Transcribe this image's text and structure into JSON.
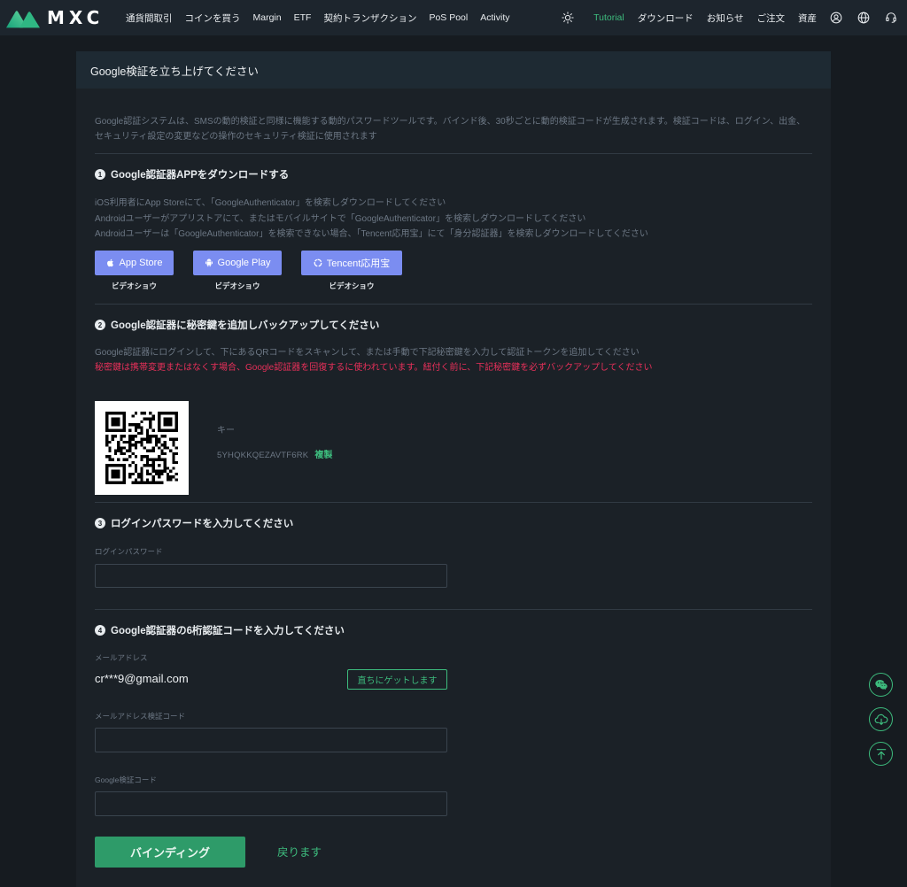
{
  "nav": {
    "logo": {
      "text": "MXC",
      "icon": "mxc-logo-icon"
    },
    "menu": [
      {
        "label": "通貨間取引"
      },
      {
        "label": "コインを買う"
      },
      {
        "label": "Margin"
      },
      {
        "label": "ETF"
      },
      {
        "label": "契約トランザクション"
      },
      {
        "label": "PoS Pool"
      },
      {
        "label": "Activity"
      }
    ],
    "theme_icon": "sun-icon",
    "right_menu": [
      {
        "label": "Tutorial"
      },
      {
        "label": "ダウンロード"
      },
      {
        "label": "お知らせ"
      },
      {
        "label": "ご注文"
      },
      {
        "label": "資産"
      }
    ],
    "right_icons": [
      "user-icon",
      "globe-icon",
      "support-icon"
    ]
  },
  "page": {
    "title": "Google検証を立ち上げてください",
    "intro": "Google認証システムは、SMSの動的検証と同様に機能する動的パスワードツールです。バインド後、30秒ごとに動的検証コードが生成されます。検証コードは、ログイン、出金、セキュリティ設定の変更などの操作のセキュリティ検証に使用されます"
  },
  "step1": {
    "number": "1",
    "title": "Google認証器APPをダウンロードする",
    "lines": [
      "iOS利用者にApp Storeにて、「GoogleAuthenticator」を検索しダウンロードしてください",
      "Androidユーザーがアプリストアにて、またはモバイルサイトで「GoogleAuthenticator」を検索しダウンロードしてください",
      "Androidユーザーは「GoogleAuthenticator」を検索できない場合、「Tencent応用宝」にて「身分認証器」を検索しダウンロードしてください"
    ],
    "downloads": [
      {
        "label": "App Store",
        "icon": "apple-icon",
        "caption": "ビデオショウ"
      },
      {
        "label": "Google Play",
        "icon": "android-icon",
        "caption": "ビデオショウ"
      },
      {
        "label": "Tencent応用宝",
        "icon": "tencent-icon",
        "caption": "ビデオショウ"
      }
    ]
  },
  "step2": {
    "number": "2",
    "title": "Google認証器に秘密鍵を追加しバックアップしてください",
    "instruction": "Google認証器にログインして、下にあるQRコードをスキャンして、または手動で下記秘密鍵を入力して認証トークンを追加してください",
    "warning": "秘密鍵は携帯変更またはなくす場合、Google認証器を回復するに使われています。紐付く前に、下記秘密鍵を必ずバックアップしてください",
    "key_label": "キー",
    "key_value": "5YHQKKQEZAVTF6RK",
    "copy_label": "複製"
  },
  "step3": {
    "number": "3",
    "title": "ログインパスワードを入力してください",
    "password_label": "ログインパスワード",
    "password_value": ""
  },
  "step4": {
    "number": "4",
    "title": "Google認証器の6桁認証コードを入力してください",
    "email_label": "メールアドレス",
    "email_value": "cr***9@gmail.com",
    "send_code_label": "直ちにゲットします",
    "email_code_label": "メールアドレス検証コード",
    "email_code_value": "",
    "google_code_label": "Google検証コード",
    "google_code_value": ""
  },
  "actions": {
    "submit_label": "バインディング",
    "back_label": "戻ります"
  },
  "floating_tools": [
    "chat-icon",
    "cloud-download-icon",
    "back-to-top-icon"
  ],
  "colors": {
    "accent": "#3dbb7d",
    "primary_button": "#2e9b69",
    "store_button": "#7b8df1",
    "warning": "#e8305a"
  }
}
